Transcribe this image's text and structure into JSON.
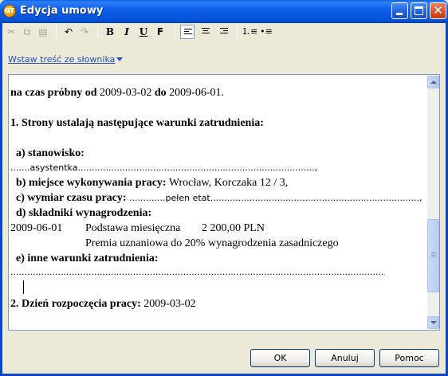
{
  "window": {
    "title": "Edycja umowy",
    "icon_name": "app-icon",
    "icon_text": "GT",
    "title_color": "#0A5EDD"
  },
  "toolbar": {
    "items": [
      "cut-icon",
      "copy-icon",
      "paste-icon",
      "undo-icon",
      "redo-icon",
      "bold-button",
      "italic-button",
      "underline-button",
      "font-button",
      "align-left-button",
      "align-center-button",
      "align-right-button",
      "numbered-list-button",
      "bulleted-list-button"
    ],
    "bold_label": "B",
    "italic_label": "I",
    "underline_label": "U",
    "font_label": "F"
  },
  "dictionary_link": "Wstaw treść ze słownika",
  "document": {
    "line1_bold": "na czas próbny od",
    "line1_date1": " 2009-03-02 ",
    "line1_bold2": "do",
    "line1_date2": " 2009-06-01.",
    "section1": "1. Strony ustalają następujące warunki zatrudnienia:",
    "a_label": "  a) stanowisko:",
    "a_value_dots_left": ".......",
    "a_value": "asystentka",
    "a_value_dots_right": ".....................................................................................,",
    "b_label": "  b) miejsce wykonywania pracy:",
    "b_value": " Wrocław, Korczaka 12 / 3,",
    "c_label": "  c) wymiar czasu pracy:",
    "c_dots_left": " .............",
    "c_value": "pełen etat",
    "c_dots_right": "...........................................................................,",
    "d_label": "  d) składniki wynagrodzenia:",
    "salary_date": "2009-06-01",
    "salary_desc": "Podstawa miesięczna",
    "salary_amount": "2 200,00 PLN",
    "bonus": "Premia uznaniowa do 20% wynagrodzenia zasadniczego",
    "e_label": "  e) inne warunki zatrudnienia:",
    "e_dots": ".........................................................................................................................................................",
    "section2_bold": "2. Dzień rozpoczęcia pracy:",
    "section2_value": " 2009-03-02"
  },
  "buttons": {
    "ok": "OK",
    "cancel": "Anuluj",
    "help": "Pomoc"
  }
}
